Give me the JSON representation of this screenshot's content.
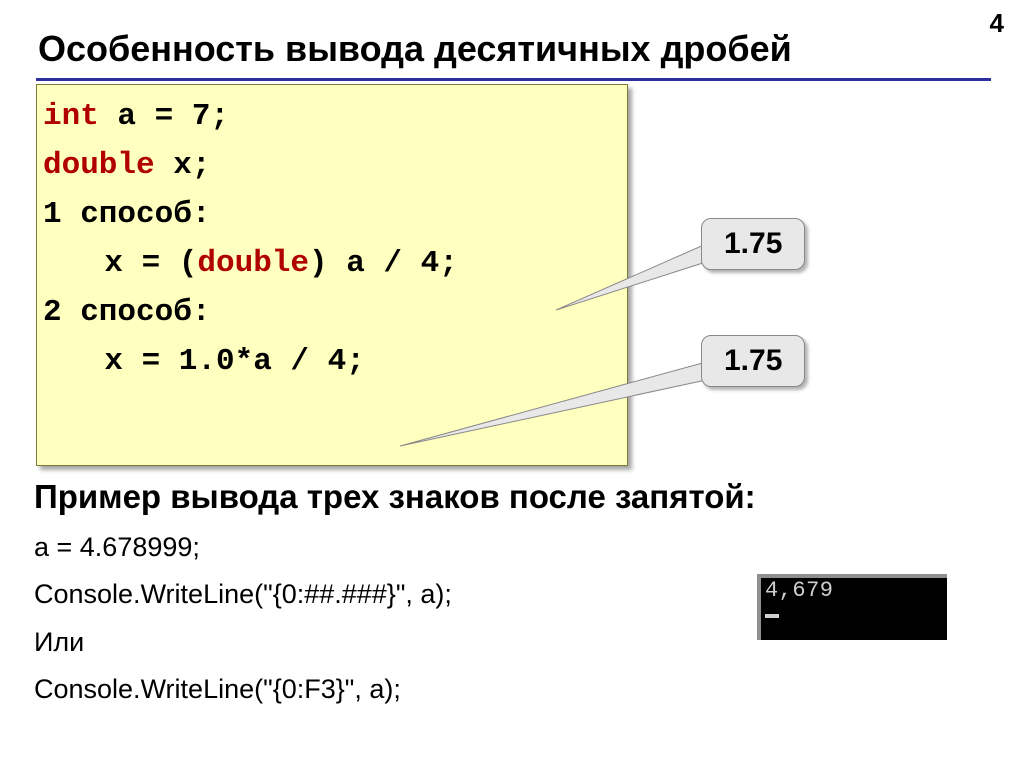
{
  "page_number": "4",
  "title": "Особенность вывода десятичных дробей",
  "code": {
    "l1_kw": "int",
    "l1_rest": " a = 7;",
    "l2_kw": "double",
    "l2_rest": " x;",
    "l3": "1 способ:",
    "l4_pre": "x = (",
    "l4_kw": "double",
    "l4_post": ") a / 4;",
    "l5": "2 способ:",
    "l6": "x = 1.0*a / 4;"
  },
  "bubble1": "1.75",
  "bubble2": "1.75",
  "subtitle": "Пример вывода трех знаков после запятой:",
  "example": {
    "l1": "a = 4.678999;",
    "l2": "Console.WriteLine(\"{0:##.###}\", a);",
    "l3": "Или",
    "l4": "Console.WriteLine(\"{0:F3}\", a);"
  },
  "console_output": "4,679"
}
